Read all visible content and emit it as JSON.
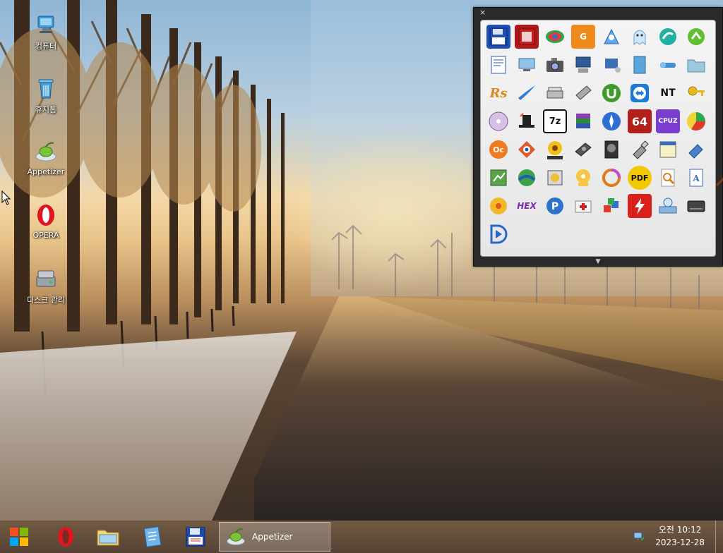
{
  "desktop": {
    "icons": [
      {
        "label": "컴퓨터",
        "icon": "computer-icon"
      },
      {
        "label": "휴지통",
        "icon": "recycle-bin-icon"
      },
      {
        "label": "Appetizer",
        "icon": "appetizer-icon"
      },
      {
        "label": "OPERA",
        "icon": "opera-icon"
      },
      {
        "label": "디스크 관리",
        "icon": "disk-management-icon"
      }
    ]
  },
  "appetizer": {
    "close_glyph": "×",
    "grip_glyph": "▼",
    "tiles": [
      "floppy-save-icon",
      "hex-viewer-icon",
      "rainbow-disc-icon",
      "g-orange-icon",
      "seeker-icon",
      "ghost-icon",
      "swirl-green-icon",
      "green-arrow-ball-icon",
      "text-editor-icon",
      "network-computer-icon",
      "camera-icon",
      "pc-desktop-icon",
      "monitor-speaker-icon",
      "book-icon",
      "pipe-tool-icon",
      "folder-fade-icon",
      "rs-icon",
      "wing-blue-icon",
      "scanner-icon",
      "drive-stack-icon",
      "utorrent-icon",
      "teamviewer-icon",
      "ntpwedit-icon",
      "key-icon",
      "cd-disc-icon",
      "magic-hat-icon",
      "7z-icon",
      "winrar-icon",
      "compass-blue-icon",
      "aida64-icon",
      "cpuz-icon",
      "chart-pie-icon",
      "oc-icon",
      "eye-diamond-icon",
      "imagine-icon",
      "hdd-drive-icon",
      "hdd-tune-icon",
      "usb-stick-icon",
      "window-app-icon",
      "usb-drive-icon",
      "process-icon",
      "earth-arrow-icon",
      "disk-utility-icon",
      "cd-hand-icon",
      "sync-circle-icon",
      "pdf-icon",
      "search-file-icon",
      "document-a-icon",
      "magic-wand-icon",
      "cd-burn-icon",
      "hex-editor-icon",
      "p-circle-icon",
      "first-aid-icon",
      "blocks-icon",
      "flash-red-icon",
      "magnifier-drive-icon",
      "ssd-icon",
      "d-play-icon"
    ],
    "tile_texts": {
      "7z": "7z",
      "aida64": "64",
      "cpuz": "CPUZ",
      "pdf": "PDF",
      "oc": "Oc",
      "rs": "Rs",
      "hex": "HEX",
      "nt": "NT"
    }
  },
  "taskbar": {
    "buttons": [
      "start-button",
      "opera-button",
      "explorer-button",
      "notepad-button",
      "save-button"
    ],
    "active_task": {
      "label": "Appetizer",
      "icon": "appetizer-icon"
    },
    "clock": {
      "time": "오전 10:12",
      "date": "2023-12-28"
    }
  }
}
